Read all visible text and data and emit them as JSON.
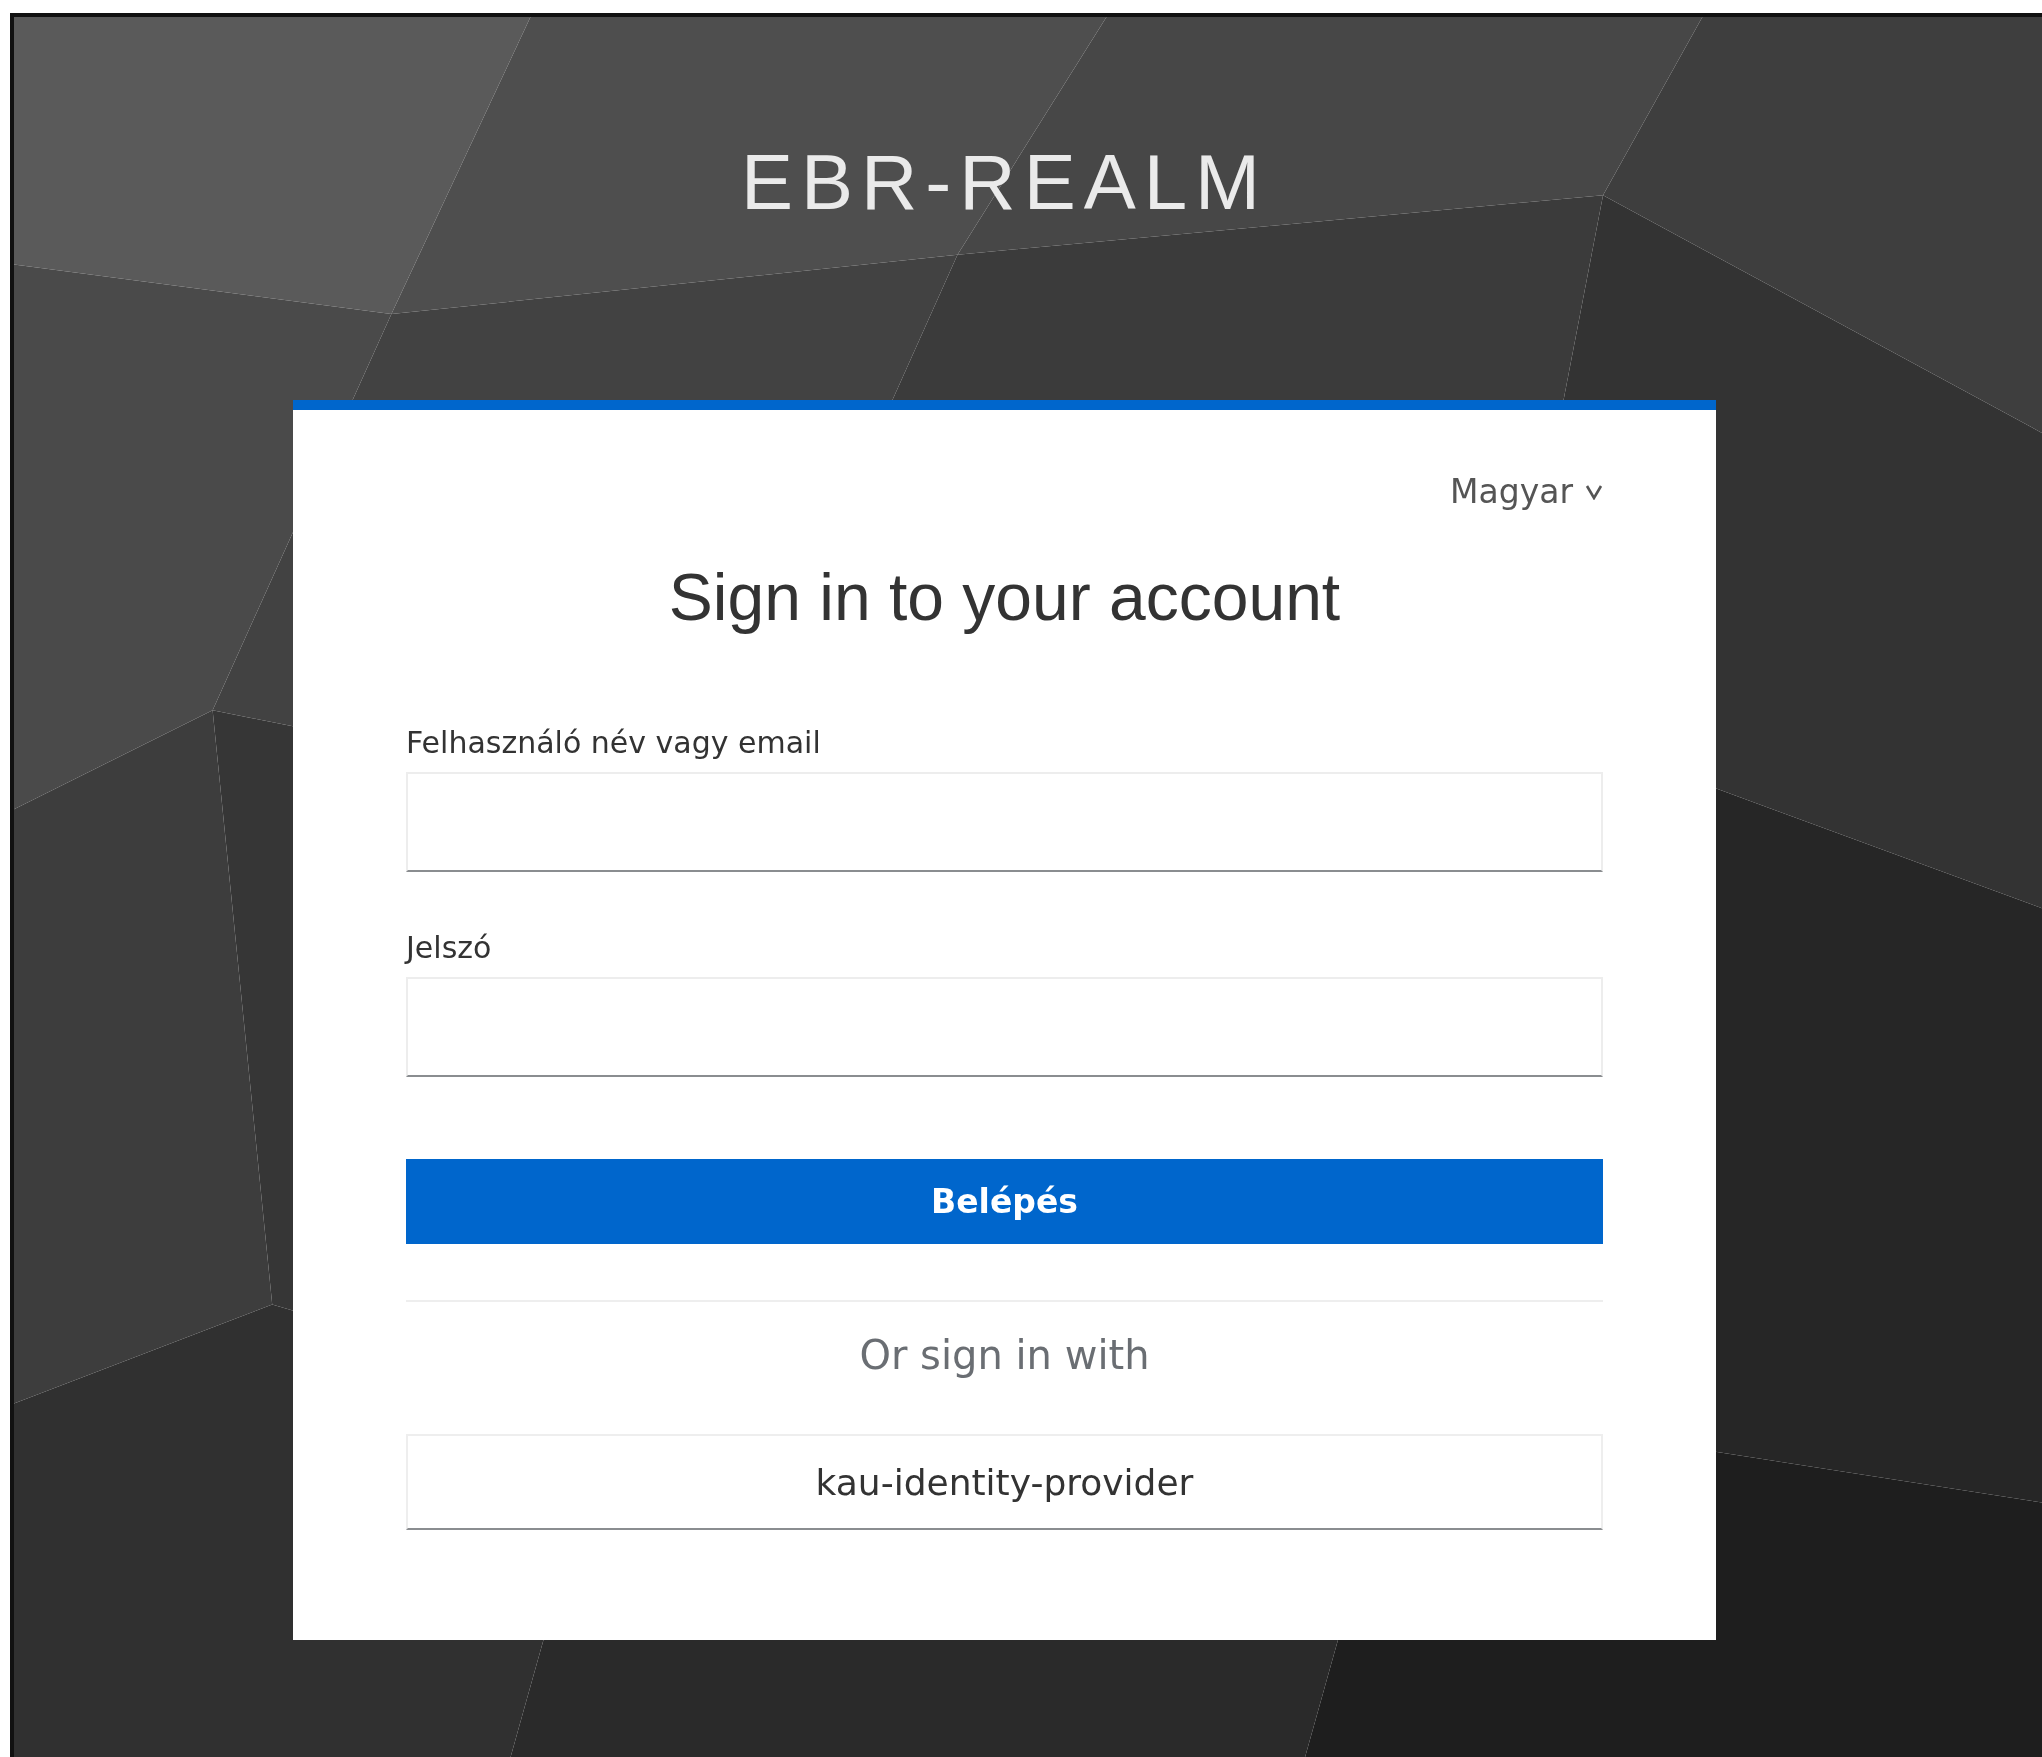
{
  "realm_title": "EBR-REALM",
  "language": {
    "label": "Magyar"
  },
  "heading": "Sign in to your account",
  "fields": [
    {
      "label": "Felhasználó név vagy email"
    },
    {
      "label": "Jelszó"
    }
  ],
  "submit": "Belépés",
  "alternative_heading": "Or sign in with",
  "providers": [
    "kau-identity-provider"
  ]
}
